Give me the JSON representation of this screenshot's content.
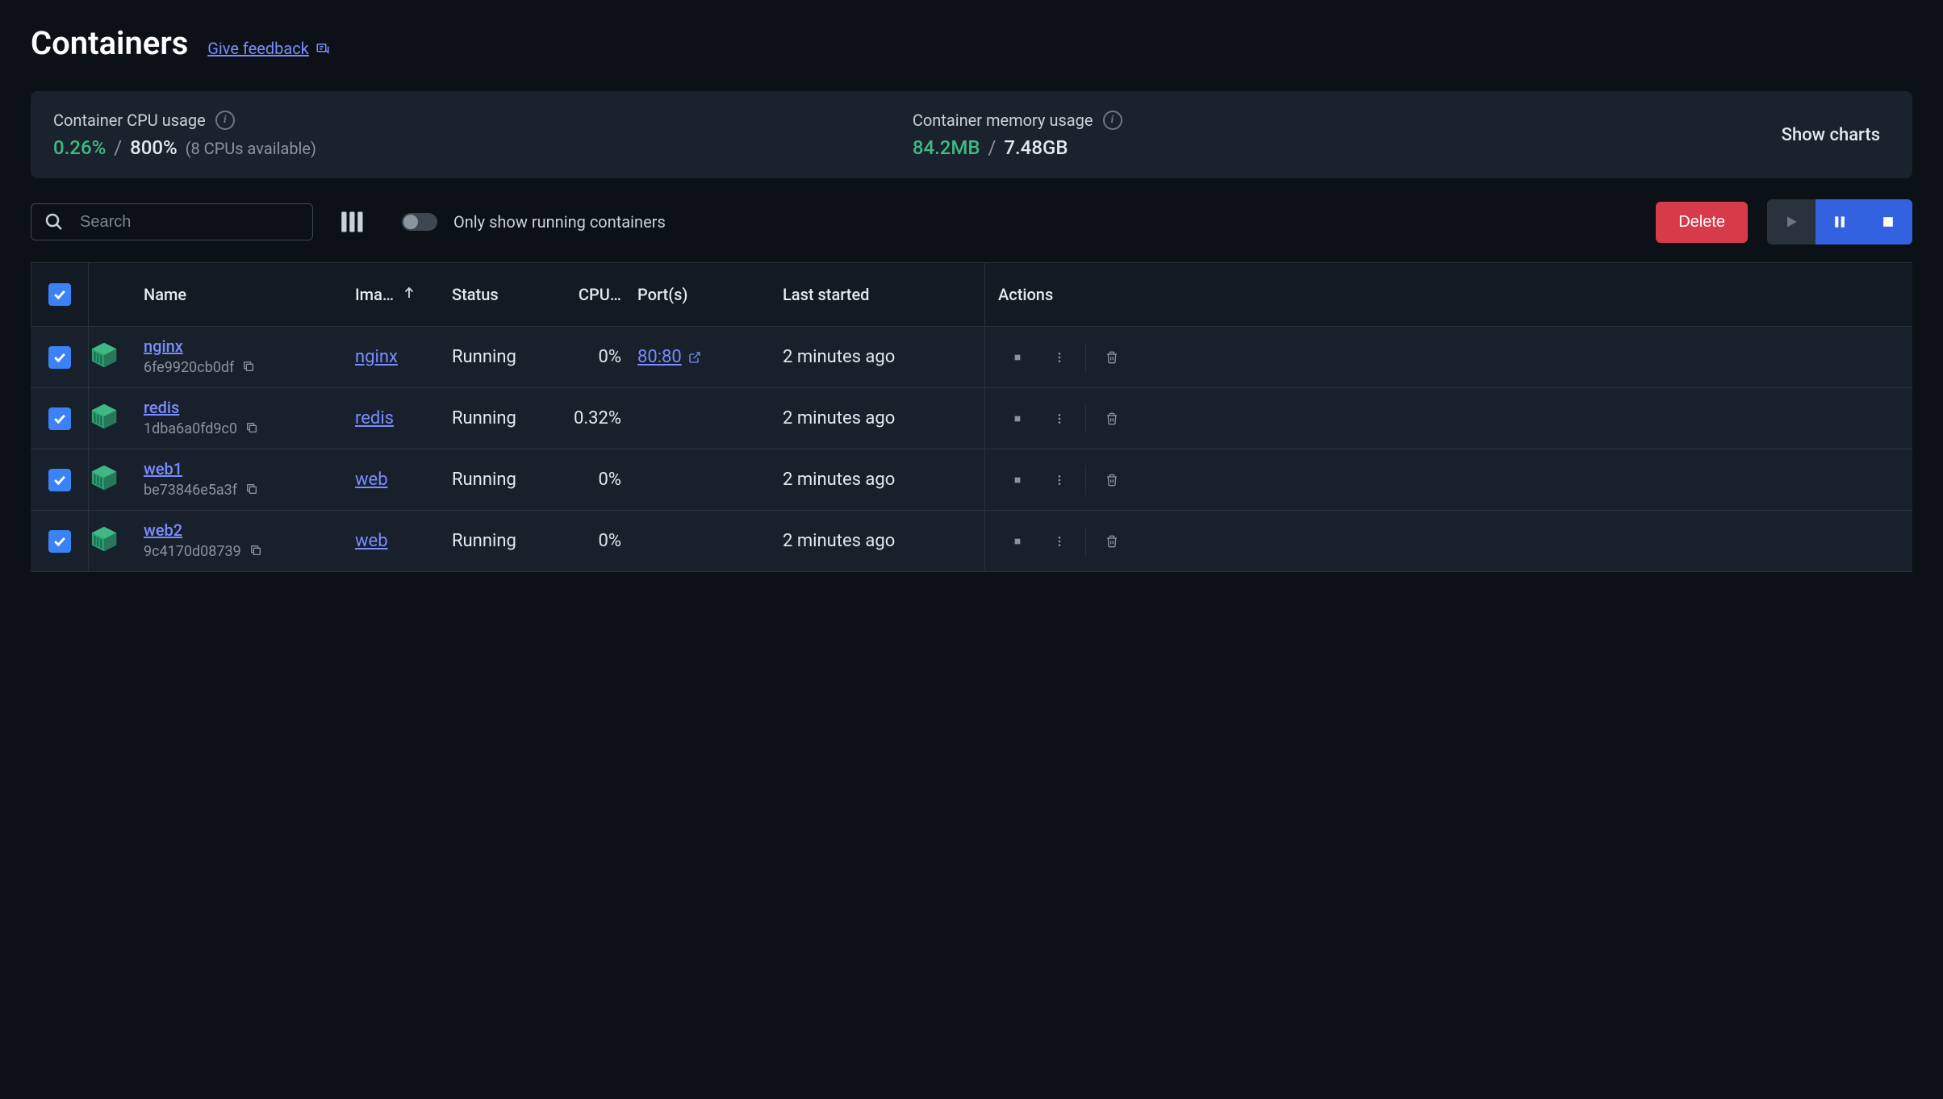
{
  "header": {
    "title": "Containers",
    "feedback_label": "Give feedback"
  },
  "stats": {
    "cpu": {
      "label": "Container CPU usage",
      "used": "0.26%",
      "total": "800%",
      "note": "(8 CPUs available)"
    },
    "memory": {
      "label": "Container memory usage",
      "used": "84.2MB",
      "total": "7.48GB"
    },
    "show_charts_label": "Show charts"
  },
  "toolbar": {
    "search_placeholder": "Search",
    "toggle_label": "Only show running containers",
    "delete_label": "Delete"
  },
  "columns": {
    "name": "Name",
    "image": "Ima…",
    "status": "Status",
    "cpu": "CPU…",
    "ports": "Port(s)",
    "started": "Last started",
    "actions": "Actions"
  },
  "rows": [
    {
      "name": "nginx",
      "hash": "6fe9920cb0df",
      "image": "nginx",
      "status": "Running",
      "cpu": "0%",
      "port": "80:80",
      "started": "2 minutes ago"
    },
    {
      "name": "redis",
      "hash": "1dba6a0fd9c0",
      "image": "redis",
      "status": "Running",
      "cpu": "0.32%",
      "port": "",
      "started": "2 minutes ago"
    },
    {
      "name": "web1",
      "hash": "be73846e5a3f",
      "image": "web",
      "status": "Running",
      "cpu": "0%",
      "port": "",
      "started": "2 minutes ago"
    },
    {
      "name": "web2",
      "hash": "9c4170d08739",
      "image": "web",
      "status": "Running",
      "cpu": "0%",
      "port": "",
      "started": "2 minutes ago"
    }
  ]
}
